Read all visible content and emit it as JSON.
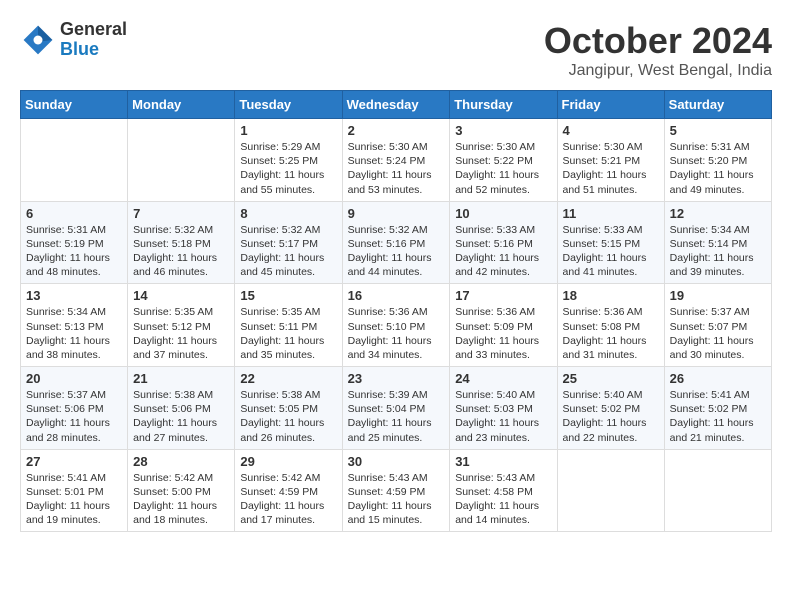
{
  "header": {
    "logo": {
      "general": "General",
      "blue": "Blue"
    },
    "title": "October 2024",
    "location": "Jangipur, West Bengal, India"
  },
  "weekdays": [
    "Sunday",
    "Monday",
    "Tuesday",
    "Wednesday",
    "Thursday",
    "Friday",
    "Saturday"
  ],
  "weeks": [
    [
      null,
      null,
      {
        "day": "1",
        "sunrise": "Sunrise: 5:29 AM",
        "sunset": "Sunset: 5:25 PM",
        "daylight": "Daylight: 11 hours and 55 minutes."
      },
      {
        "day": "2",
        "sunrise": "Sunrise: 5:30 AM",
        "sunset": "Sunset: 5:24 PM",
        "daylight": "Daylight: 11 hours and 53 minutes."
      },
      {
        "day": "3",
        "sunrise": "Sunrise: 5:30 AM",
        "sunset": "Sunset: 5:22 PM",
        "daylight": "Daylight: 11 hours and 52 minutes."
      },
      {
        "day": "4",
        "sunrise": "Sunrise: 5:30 AM",
        "sunset": "Sunset: 5:21 PM",
        "daylight": "Daylight: 11 hours and 51 minutes."
      },
      {
        "day": "5",
        "sunrise": "Sunrise: 5:31 AM",
        "sunset": "Sunset: 5:20 PM",
        "daylight": "Daylight: 11 hours and 49 minutes."
      }
    ],
    [
      {
        "day": "6",
        "sunrise": "Sunrise: 5:31 AM",
        "sunset": "Sunset: 5:19 PM",
        "daylight": "Daylight: 11 hours and 48 minutes."
      },
      {
        "day": "7",
        "sunrise": "Sunrise: 5:32 AM",
        "sunset": "Sunset: 5:18 PM",
        "daylight": "Daylight: 11 hours and 46 minutes."
      },
      {
        "day": "8",
        "sunrise": "Sunrise: 5:32 AM",
        "sunset": "Sunset: 5:17 PM",
        "daylight": "Daylight: 11 hours and 45 minutes."
      },
      {
        "day": "9",
        "sunrise": "Sunrise: 5:32 AM",
        "sunset": "Sunset: 5:16 PM",
        "daylight": "Daylight: 11 hours and 44 minutes."
      },
      {
        "day": "10",
        "sunrise": "Sunrise: 5:33 AM",
        "sunset": "Sunset: 5:16 PM",
        "daylight": "Daylight: 11 hours and 42 minutes."
      },
      {
        "day": "11",
        "sunrise": "Sunrise: 5:33 AM",
        "sunset": "Sunset: 5:15 PM",
        "daylight": "Daylight: 11 hours and 41 minutes."
      },
      {
        "day": "12",
        "sunrise": "Sunrise: 5:34 AM",
        "sunset": "Sunset: 5:14 PM",
        "daylight": "Daylight: 11 hours and 39 minutes."
      }
    ],
    [
      {
        "day": "13",
        "sunrise": "Sunrise: 5:34 AM",
        "sunset": "Sunset: 5:13 PM",
        "daylight": "Daylight: 11 hours and 38 minutes."
      },
      {
        "day": "14",
        "sunrise": "Sunrise: 5:35 AM",
        "sunset": "Sunset: 5:12 PM",
        "daylight": "Daylight: 11 hours and 37 minutes."
      },
      {
        "day": "15",
        "sunrise": "Sunrise: 5:35 AM",
        "sunset": "Sunset: 5:11 PM",
        "daylight": "Daylight: 11 hours and 35 minutes."
      },
      {
        "day": "16",
        "sunrise": "Sunrise: 5:36 AM",
        "sunset": "Sunset: 5:10 PM",
        "daylight": "Daylight: 11 hours and 34 minutes."
      },
      {
        "day": "17",
        "sunrise": "Sunrise: 5:36 AM",
        "sunset": "Sunset: 5:09 PM",
        "daylight": "Daylight: 11 hours and 33 minutes."
      },
      {
        "day": "18",
        "sunrise": "Sunrise: 5:36 AM",
        "sunset": "Sunset: 5:08 PM",
        "daylight": "Daylight: 11 hours and 31 minutes."
      },
      {
        "day": "19",
        "sunrise": "Sunrise: 5:37 AM",
        "sunset": "Sunset: 5:07 PM",
        "daylight": "Daylight: 11 hours and 30 minutes."
      }
    ],
    [
      {
        "day": "20",
        "sunrise": "Sunrise: 5:37 AM",
        "sunset": "Sunset: 5:06 PM",
        "daylight": "Daylight: 11 hours and 28 minutes."
      },
      {
        "day": "21",
        "sunrise": "Sunrise: 5:38 AM",
        "sunset": "Sunset: 5:06 PM",
        "daylight": "Daylight: 11 hours and 27 minutes."
      },
      {
        "day": "22",
        "sunrise": "Sunrise: 5:38 AM",
        "sunset": "Sunset: 5:05 PM",
        "daylight": "Daylight: 11 hours and 26 minutes."
      },
      {
        "day": "23",
        "sunrise": "Sunrise: 5:39 AM",
        "sunset": "Sunset: 5:04 PM",
        "daylight": "Daylight: 11 hours and 25 minutes."
      },
      {
        "day": "24",
        "sunrise": "Sunrise: 5:40 AM",
        "sunset": "Sunset: 5:03 PM",
        "daylight": "Daylight: 11 hours and 23 minutes."
      },
      {
        "day": "25",
        "sunrise": "Sunrise: 5:40 AM",
        "sunset": "Sunset: 5:02 PM",
        "daylight": "Daylight: 11 hours and 22 minutes."
      },
      {
        "day": "26",
        "sunrise": "Sunrise: 5:41 AM",
        "sunset": "Sunset: 5:02 PM",
        "daylight": "Daylight: 11 hours and 21 minutes."
      }
    ],
    [
      {
        "day": "27",
        "sunrise": "Sunrise: 5:41 AM",
        "sunset": "Sunset: 5:01 PM",
        "daylight": "Daylight: 11 hours and 19 minutes."
      },
      {
        "day": "28",
        "sunrise": "Sunrise: 5:42 AM",
        "sunset": "Sunset: 5:00 PM",
        "daylight": "Daylight: 11 hours and 18 minutes."
      },
      {
        "day": "29",
        "sunrise": "Sunrise: 5:42 AM",
        "sunset": "Sunset: 4:59 PM",
        "daylight": "Daylight: 11 hours and 17 minutes."
      },
      {
        "day": "30",
        "sunrise": "Sunrise: 5:43 AM",
        "sunset": "Sunset: 4:59 PM",
        "daylight": "Daylight: 11 hours and 15 minutes."
      },
      {
        "day": "31",
        "sunrise": "Sunrise: 5:43 AM",
        "sunset": "Sunset: 4:58 PM",
        "daylight": "Daylight: 11 hours and 14 minutes."
      },
      null,
      null
    ]
  ]
}
